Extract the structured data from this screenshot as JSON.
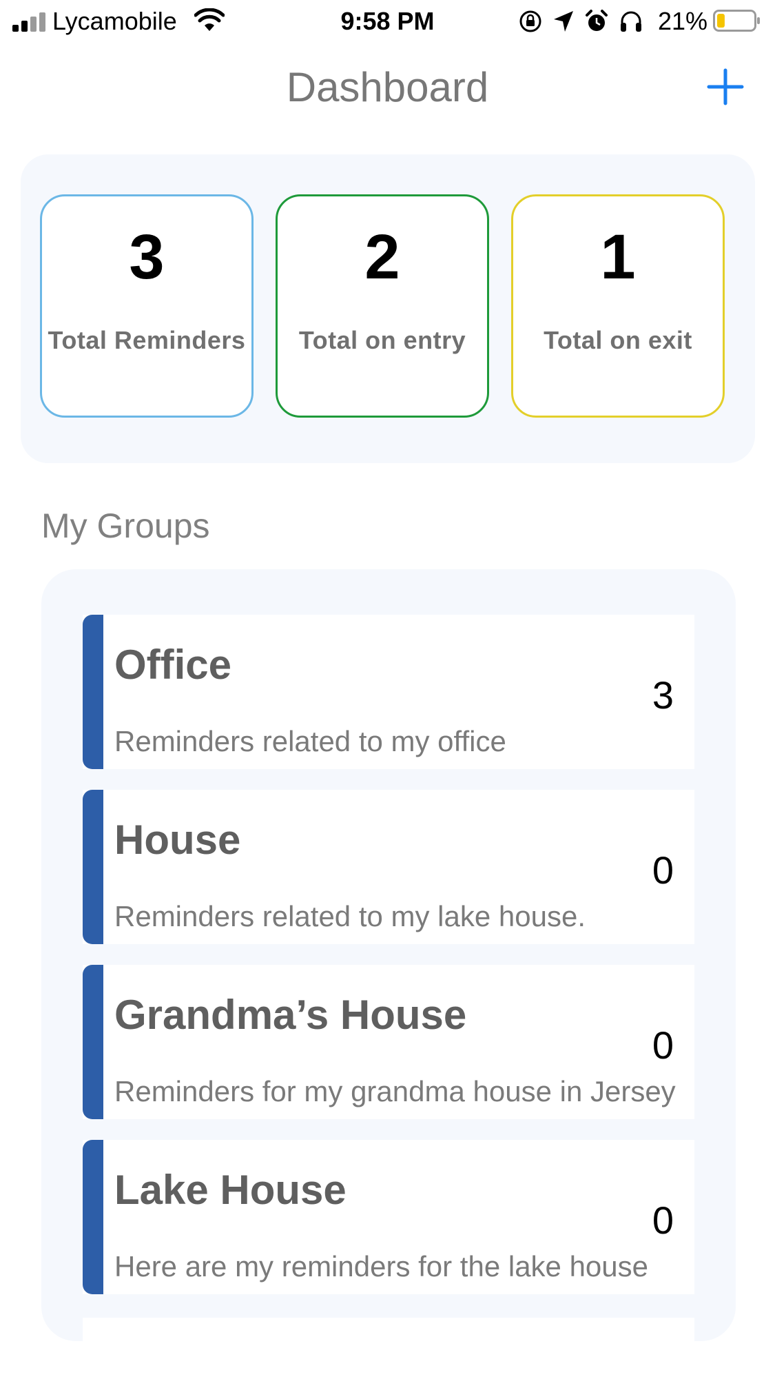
{
  "status_bar": {
    "carrier": "Lycamobile",
    "time": "9:58 PM",
    "battery_percent": "21%",
    "battery_level": 0.21,
    "signal_bars_filled": 2,
    "signal_bars_total": 4,
    "icons": [
      "signal-icon",
      "wifi-icon",
      "orientation-lock-icon",
      "location-arrow-icon",
      "alarm-icon",
      "headphones-icon",
      "battery-icon"
    ]
  },
  "header": {
    "title": "Dashboard",
    "add_icon": "plus-icon",
    "accent_color": "#1a7ff0"
  },
  "stats": [
    {
      "value": "3",
      "label": "Total Reminders",
      "border_color": "#6bb7e6"
    },
    {
      "value": "2",
      "label": "Total on entry",
      "border_color": "#1e9a3a"
    },
    {
      "value": "1",
      "label": "Total on exit",
      "border_color": "#e3cf2a"
    }
  ],
  "groups_section": {
    "title": "My Groups",
    "accent_color": "#2d5ea8",
    "items": [
      {
        "name": "Office",
        "count": "3",
        "description": "Reminders related to my office"
      },
      {
        "name": "House",
        "count": "0",
        "description": "Reminders related to my lake house."
      },
      {
        "name": "Grandma’s House",
        "count": "0",
        "description": "Reminders for my grandma house in Jersey"
      },
      {
        "name": "Lake House",
        "count": "0",
        "description": "Here are my reminders for the lake house"
      }
    ]
  }
}
